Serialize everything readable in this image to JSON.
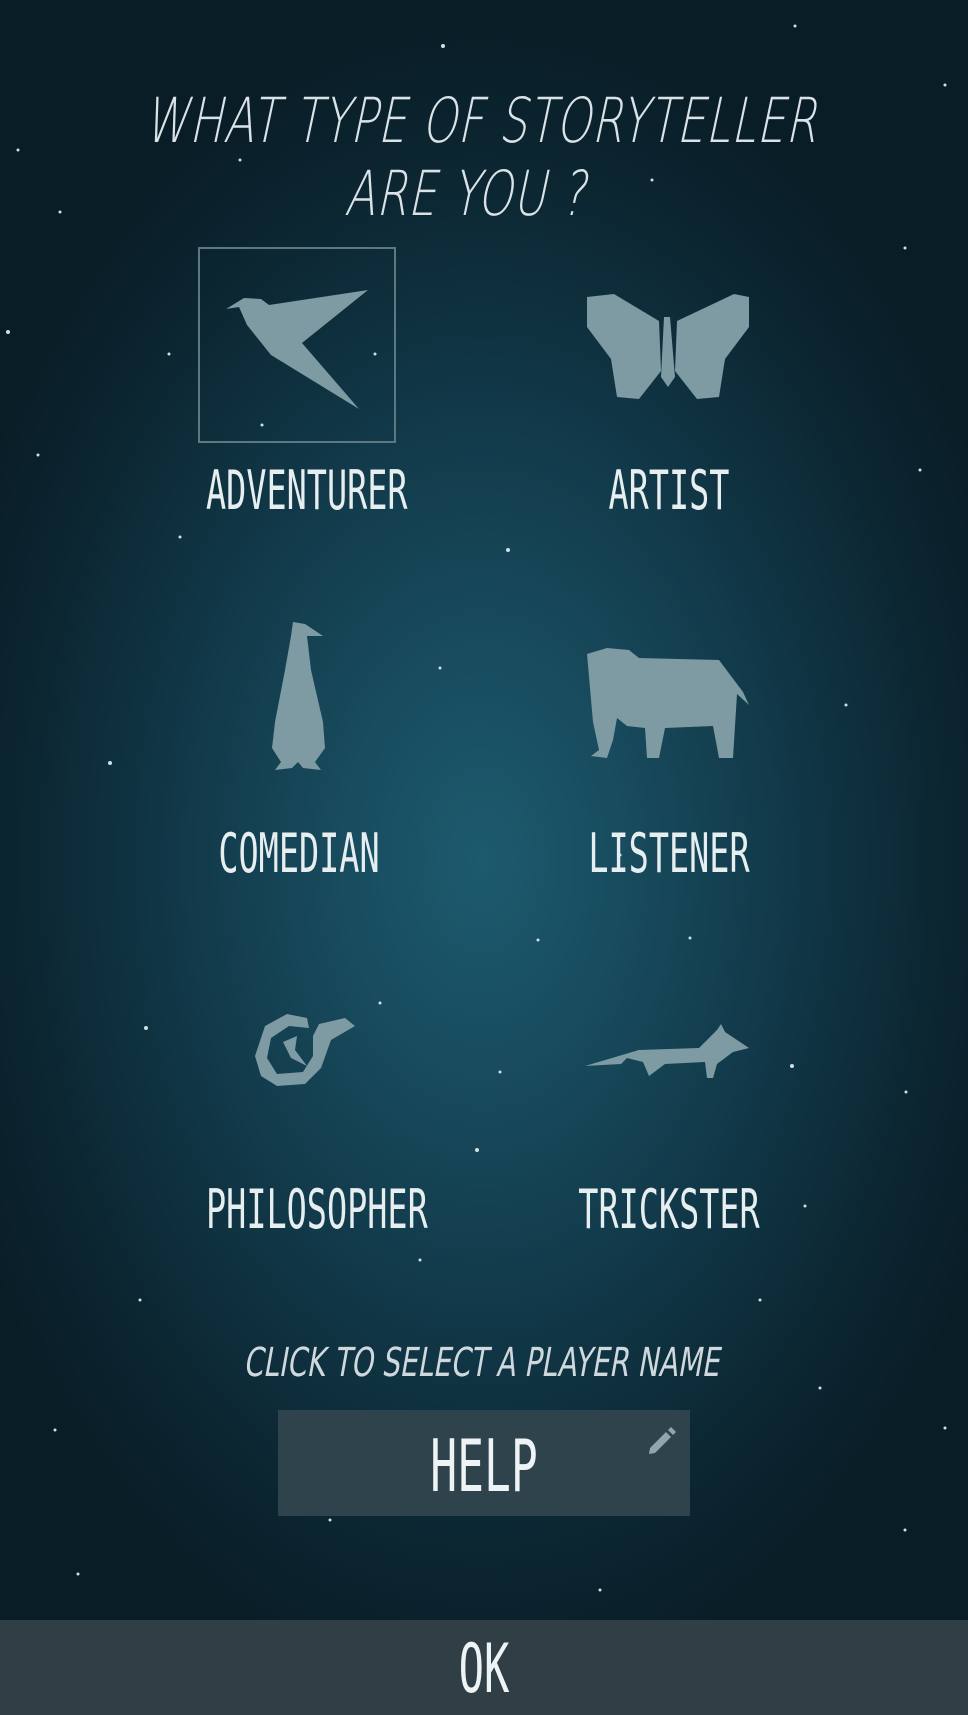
{
  "title": "WHAT TYPE OF STORYTELLER ARE YOU ?",
  "storytellers": [
    {
      "label": "ADVENTURER",
      "icon": "bird-icon",
      "selected": true
    },
    {
      "label": "ARTIST",
      "icon": "butterfly-icon",
      "selected": false
    },
    {
      "label": "COMEDIAN",
      "icon": "penguin-icon",
      "selected": false
    },
    {
      "label": "LISTENER",
      "icon": "elephant-icon",
      "selected": false
    },
    {
      "label": "PHILOSOPHER",
      "icon": "snake-icon",
      "selected": false
    },
    {
      "label": "TRICKSTER",
      "icon": "fox-icon",
      "selected": false
    }
  ],
  "player_name": {
    "hint": "CLICK TO SELECT A PLAYER NAME",
    "value": "HELP",
    "edit_icon": "pencil-icon"
  },
  "ok_label": "OK",
  "colors": {
    "icon_fill": "#7e9aa3",
    "selection_border": "#5e7880",
    "name_box_bg": "#2e434c",
    "ok_bar_bg": "#2f3f45"
  }
}
